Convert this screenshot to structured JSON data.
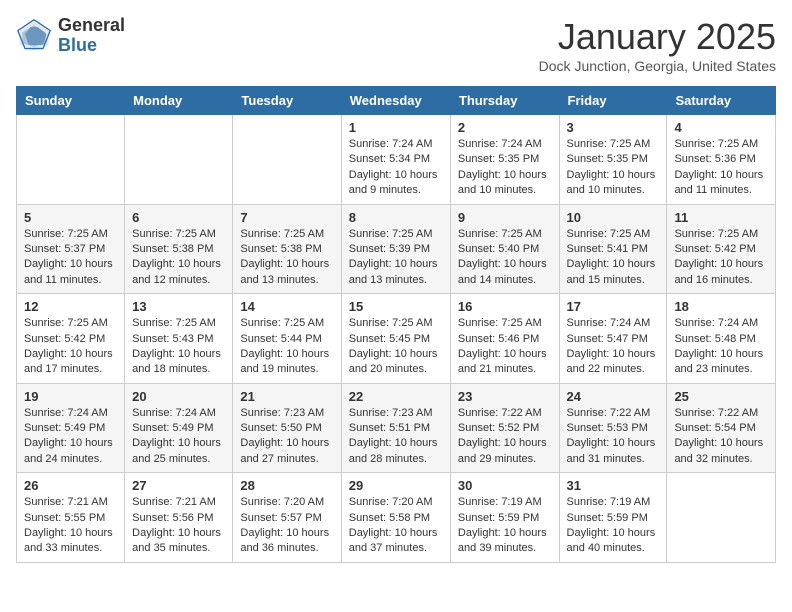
{
  "header": {
    "logo_general": "General",
    "logo_blue": "Blue",
    "month_title": "January 2025",
    "location": "Dock Junction, Georgia, United States"
  },
  "days_of_week": [
    "Sunday",
    "Monday",
    "Tuesday",
    "Wednesday",
    "Thursday",
    "Friday",
    "Saturday"
  ],
  "weeks": [
    [
      {
        "day": "",
        "info": ""
      },
      {
        "day": "",
        "info": ""
      },
      {
        "day": "",
        "info": ""
      },
      {
        "day": "1",
        "info": "Sunrise: 7:24 AM\nSunset: 5:34 PM\nDaylight: 10 hours\nand 9 minutes."
      },
      {
        "day": "2",
        "info": "Sunrise: 7:24 AM\nSunset: 5:35 PM\nDaylight: 10 hours\nand 10 minutes."
      },
      {
        "day": "3",
        "info": "Sunrise: 7:25 AM\nSunset: 5:35 PM\nDaylight: 10 hours\nand 10 minutes."
      },
      {
        "day": "4",
        "info": "Sunrise: 7:25 AM\nSunset: 5:36 PM\nDaylight: 10 hours\nand 11 minutes."
      }
    ],
    [
      {
        "day": "5",
        "info": "Sunrise: 7:25 AM\nSunset: 5:37 PM\nDaylight: 10 hours\nand 11 minutes."
      },
      {
        "day": "6",
        "info": "Sunrise: 7:25 AM\nSunset: 5:38 PM\nDaylight: 10 hours\nand 12 minutes."
      },
      {
        "day": "7",
        "info": "Sunrise: 7:25 AM\nSunset: 5:38 PM\nDaylight: 10 hours\nand 13 minutes."
      },
      {
        "day": "8",
        "info": "Sunrise: 7:25 AM\nSunset: 5:39 PM\nDaylight: 10 hours\nand 13 minutes."
      },
      {
        "day": "9",
        "info": "Sunrise: 7:25 AM\nSunset: 5:40 PM\nDaylight: 10 hours\nand 14 minutes."
      },
      {
        "day": "10",
        "info": "Sunrise: 7:25 AM\nSunset: 5:41 PM\nDaylight: 10 hours\nand 15 minutes."
      },
      {
        "day": "11",
        "info": "Sunrise: 7:25 AM\nSunset: 5:42 PM\nDaylight: 10 hours\nand 16 minutes."
      }
    ],
    [
      {
        "day": "12",
        "info": "Sunrise: 7:25 AM\nSunset: 5:42 PM\nDaylight: 10 hours\nand 17 minutes."
      },
      {
        "day": "13",
        "info": "Sunrise: 7:25 AM\nSunset: 5:43 PM\nDaylight: 10 hours\nand 18 minutes."
      },
      {
        "day": "14",
        "info": "Sunrise: 7:25 AM\nSunset: 5:44 PM\nDaylight: 10 hours\nand 19 minutes."
      },
      {
        "day": "15",
        "info": "Sunrise: 7:25 AM\nSunset: 5:45 PM\nDaylight: 10 hours\nand 20 minutes."
      },
      {
        "day": "16",
        "info": "Sunrise: 7:25 AM\nSunset: 5:46 PM\nDaylight: 10 hours\nand 21 minutes."
      },
      {
        "day": "17",
        "info": "Sunrise: 7:24 AM\nSunset: 5:47 PM\nDaylight: 10 hours\nand 22 minutes."
      },
      {
        "day": "18",
        "info": "Sunrise: 7:24 AM\nSunset: 5:48 PM\nDaylight: 10 hours\nand 23 minutes."
      }
    ],
    [
      {
        "day": "19",
        "info": "Sunrise: 7:24 AM\nSunset: 5:49 PM\nDaylight: 10 hours\nand 24 minutes."
      },
      {
        "day": "20",
        "info": "Sunrise: 7:24 AM\nSunset: 5:49 PM\nDaylight: 10 hours\nand 25 minutes."
      },
      {
        "day": "21",
        "info": "Sunrise: 7:23 AM\nSunset: 5:50 PM\nDaylight: 10 hours\nand 27 minutes."
      },
      {
        "day": "22",
        "info": "Sunrise: 7:23 AM\nSunset: 5:51 PM\nDaylight: 10 hours\nand 28 minutes."
      },
      {
        "day": "23",
        "info": "Sunrise: 7:22 AM\nSunset: 5:52 PM\nDaylight: 10 hours\nand 29 minutes."
      },
      {
        "day": "24",
        "info": "Sunrise: 7:22 AM\nSunset: 5:53 PM\nDaylight: 10 hours\nand 31 minutes."
      },
      {
        "day": "25",
        "info": "Sunrise: 7:22 AM\nSunset: 5:54 PM\nDaylight: 10 hours\nand 32 minutes."
      }
    ],
    [
      {
        "day": "26",
        "info": "Sunrise: 7:21 AM\nSunset: 5:55 PM\nDaylight: 10 hours\nand 33 minutes."
      },
      {
        "day": "27",
        "info": "Sunrise: 7:21 AM\nSunset: 5:56 PM\nDaylight: 10 hours\nand 35 minutes."
      },
      {
        "day": "28",
        "info": "Sunrise: 7:20 AM\nSunset: 5:57 PM\nDaylight: 10 hours\nand 36 minutes."
      },
      {
        "day": "29",
        "info": "Sunrise: 7:20 AM\nSunset: 5:58 PM\nDaylight: 10 hours\nand 37 minutes."
      },
      {
        "day": "30",
        "info": "Sunrise: 7:19 AM\nSunset: 5:59 PM\nDaylight: 10 hours\nand 39 minutes."
      },
      {
        "day": "31",
        "info": "Sunrise: 7:19 AM\nSunset: 5:59 PM\nDaylight: 10 hours\nand 40 minutes."
      },
      {
        "day": "",
        "info": ""
      }
    ]
  ]
}
